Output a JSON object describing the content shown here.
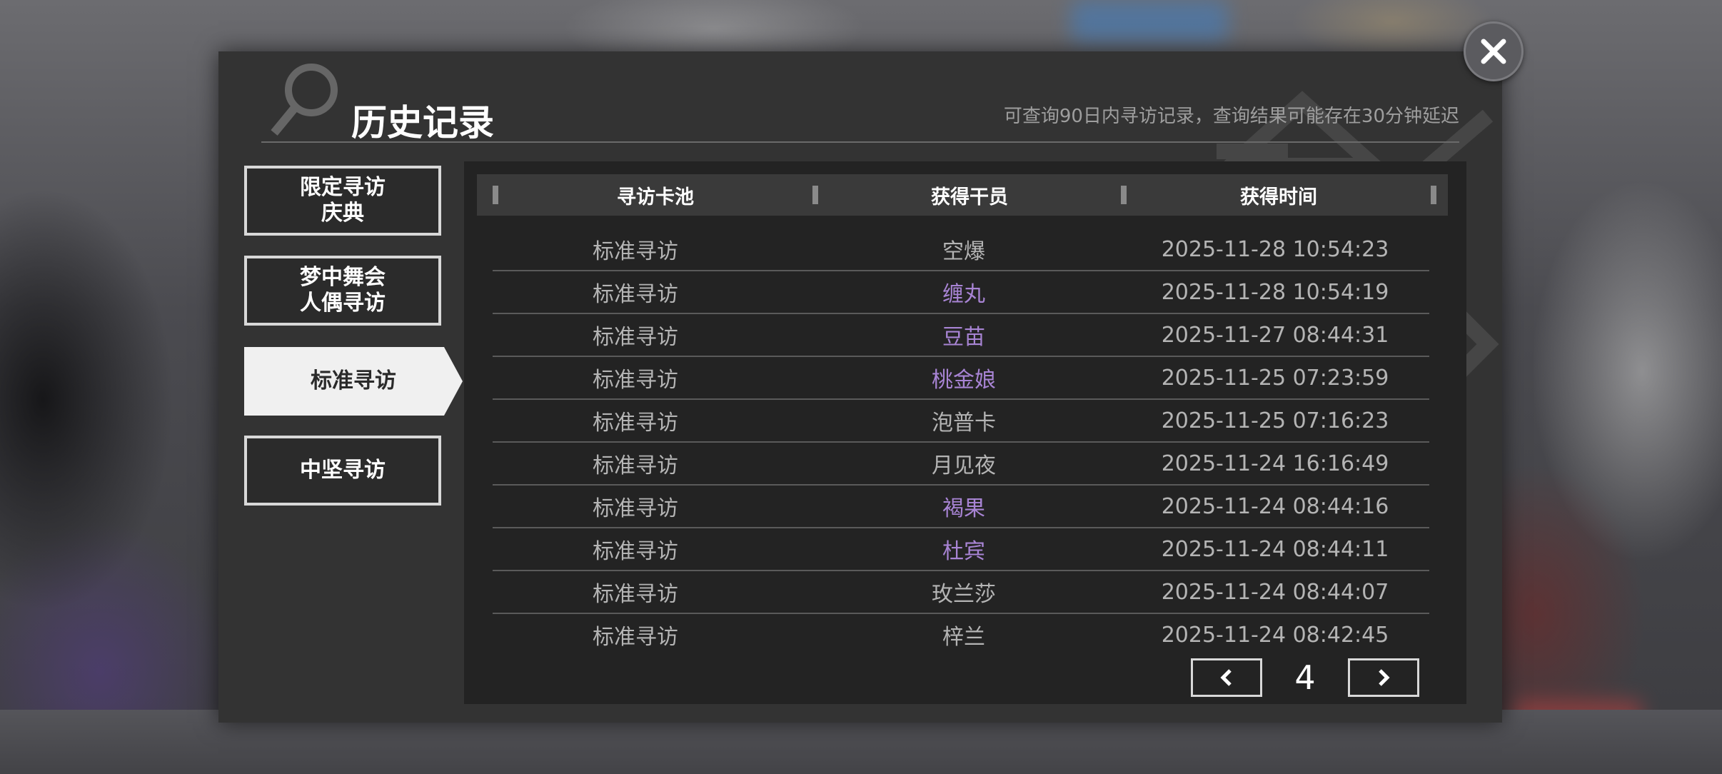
{
  "dialog": {
    "title": "历史记录",
    "notice": "可查询90日内寻访记录，查询结果可能存在30分钟延迟"
  },
  "tabs": [
    {
      "line1": "限定寻访",
      "line2": "庆典"
    },
    {
      "line1": "梦中舞会",
      "line2": "人偶寻访"
    },
    {
      "line1": "标准寻访",
      "line2": ""
    },
    {
      "line1": "中坚寻访",
      "line2": ""
    }
  ],
  "active_tab_index": 2,
  "table": {
    "headers": [
      "寻访卡池",
      "获得干员",
      "获得时间"
    ],
    "rows": [
      {
        "pool": "标准寻访",
        "operator": "空爆",
        "time": "2025-11-28 10:54:23",
        "highlight": false
      },
      {
        "pool": "标准寻访",
        "operator": "缠丸",
        "time": "2025-11-28 10:54:19",
        "highlight": true
      },
      {
        "pool": "标准寻访",
        "operator": "豆苗",
        "time": "2025-11-27 08:44:31",
        "highlight": true
      },
      {
        "pool": "标准寻访",
        "operator": "桃金娘",
        "time": "2025-11-25 07:23:59",
        "highlight": true
      },
      {
        "pool": "标准寻访",
        "operator": "泡普卡",
        "time": "2025-11-25 07:16:23",
        "highlight": false
      },
      {
        "pool": "标准寻访",
        "operator": "月见夜",
        "time": "2025-11-24 16:16:49",
        "highlight": false
      },
      {
        "pool": "标准寻访",
        "operator": "褐果",
        "time": "2025-11-24 08:44:16",
        "highlight": true
      },
      {
        "pool": "标准寻访",
        "operator": "杜宾",
        "time": "2025-11-24 08:44:11",
        "highlight": true
      },
      {
        "pool": "标准寻访",
        "operator": "玫兰莎",
        "time": "2025-11-24 08:44:07",
        "highlight": false
      },
      {
        "pool": "标准寻访",
        "operator": "梓兰",
        "time": "2025-11-24 08:42:45",
        "highlight": false
      }
    ]
  },
  "pagination": {
    "page": "4"
  },
  "icons": {
    "close": "close-icon",
    "prev": "chevron-left-icon",
    "next": "chevron-right-icon",
    "title": "magnifier-icon"
  },
  "colors": {
    "panel": "#333333",
    "table_bg": "#232323",
    "header_bg": "#3a3a3a",
    "text": "#b4b4b4",
    "rare_text": "#a884d4",
    "active_tab": "#f0f0f0"
  }
}
